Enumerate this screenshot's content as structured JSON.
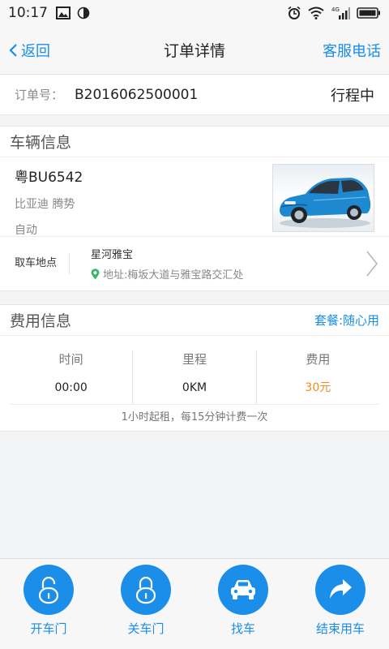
{
  "status_bar": {
    "time": "10:17",
    "network": "4G"
  },
  "nav": {
    "back_label": "返回",
    "title": "订单详情",
    "right_label": "客服电话"
  },
  "order": {
    "label": "订单号：",
    "number": "B2016062500001",
    "status": "行程中"
  },
  "vehicle_section": {
    "title": "车辆信息",
    "plate": "粤BU6542",
    "model": "比亚迪 腾势",
    "transmission": "自动",
    "pickup_label": "取车地点",
    "pickup_name": "星河雅宝",
    "pickup_address": "地址:梅坂大道与雅宝路交汇处"
  },
  "fee_section": {
    "title": "费用信息",
    "package": "套餐:随心用",
    "columns": [
      {
        "header": "时间",
        "value": "00:00"
      },
      {
        "header": "里程",
        "value": "0KM"
      },
      {
        "header": "费用",
        "value": "30元"
      }
    ],
    "note": "1小时起租，每15分钟计费一次"
  },
  "actions": [
    {
      "label": "开车门",
      "icon": "unlock-icon"
    },
    {
      "label": "关车门",
      "icon": "lock-icon"
    },
    {
      "label": "找车",
      "icon": "car-icon"
    },
    {
      "label": "结束用车",
      "icon": "share-arrow-icon"
    }
  ],
  "colors": {
    "accent": "#1a8ee8",
    "fee": "#f08a1c",
    "car_body": "#1e88d0"
  }
}
